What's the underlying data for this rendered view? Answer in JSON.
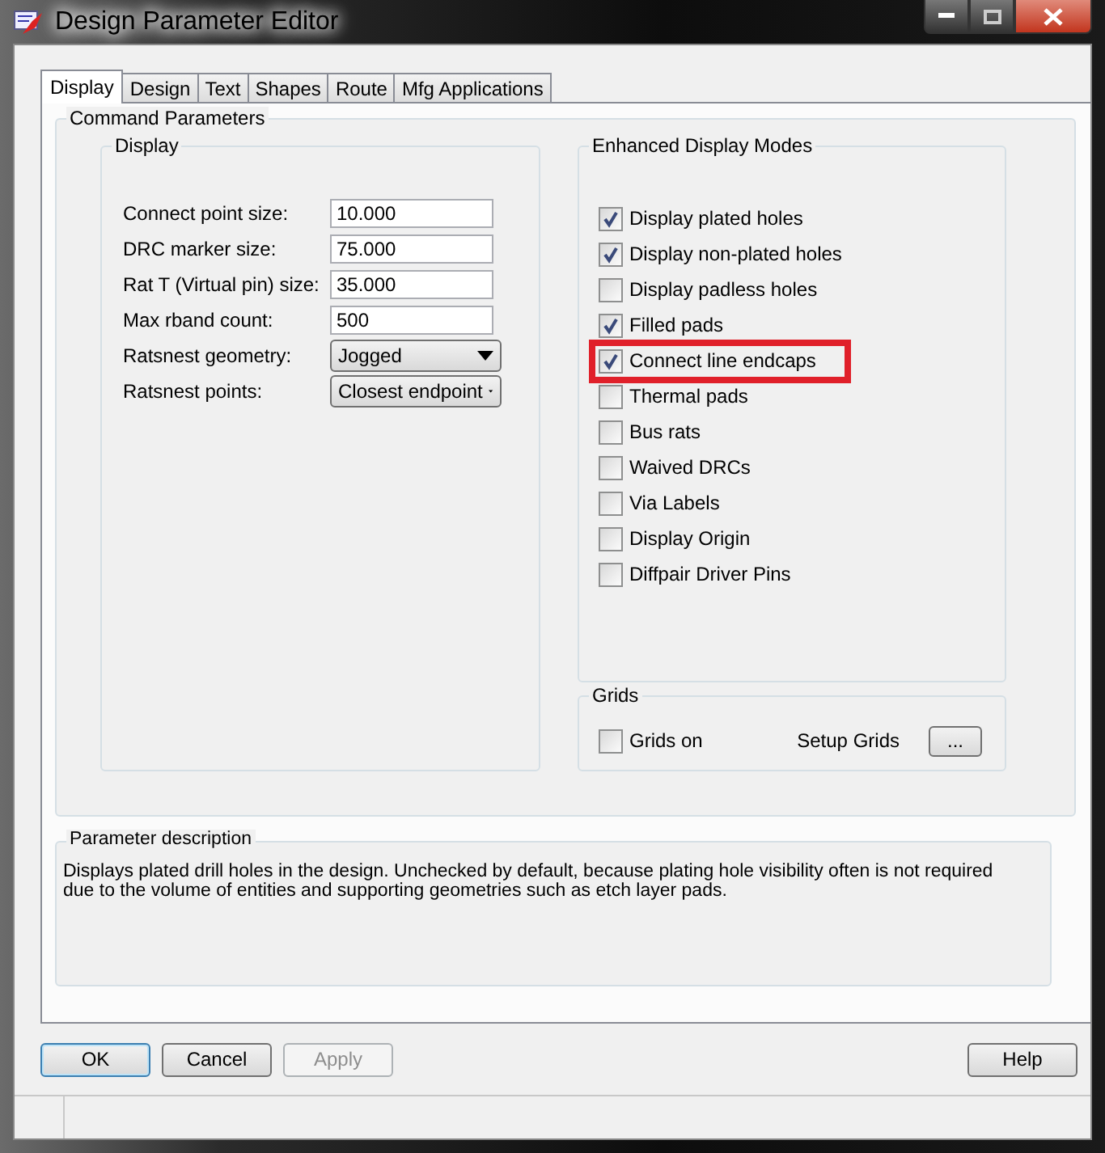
{
  "window": {
    "title": "Design Parameter Editor"
  },
  "tabs": [
    {
      "label": "Display",
      "selected": true
    },
    {
      "label": "Design",
      "selected": false
    },
    {
      "label": "Text",
      "selected": false
    },
    {
      "label": "Shapes",
      "selected": false
    },
    {
      "label": "Route",
      "selected": false
    },
    {
      "label": "Mfg Applications",
      "selected": false
    }
  ],
  "command_parameters": {
    "title": "Command Parameters",
    "display": {
      "title": "Display",
      "fields": [
        {
          "kind": "text",
          "label": "Connect point size:",
          "value": "10.000"
        },
        {
          "kind": "text",
          "label": "DRC marker size:",
          "value": "75.000"
        },
        {
          "kind": "text",
          "label": "Rat T (Virtual pin) size:",
          "value": "35.000"
        },
        {
          "kind": "text",
          "label": "Max rband count:",
          "value": "500"
        },
        {
          "kind": "dropdown",
          "label": "Ratsnest geometry:",
          "value": "Jogged"
        },
        {
          "kind": "dropdown",
          "label": "Ratsnest points:",
          "value": "Closest endpoint"
        }
      ]
    },
    "enhanced_display_modes": {
      "title": "Enhanced Display Modes",
      "options": [
        {
          "label": "Display plated holes",
          "checked": true
        },
        {
          "label": "Display non-plated holes",
          "checked": true
        },
        {
          "label": "Display padless holes",
          "checked": false
        },
        {
          "label": "Filled pads",
          "checked": true
        },
        {
          "label": "Connect line endcaps",
          "checked": true,
          "highlighted": true
        },
        {
          "label": "Thermal pads",
          "checked": false
        },
        {
          "label": "Bus rats",
          "checked": false
        },
        {
          "label": "Waived DRCs",
          "checked": false
        },
        {
          "label": "Via Labels",
          "checked": false
        },
        {
          "label": "Display Origin",
          "checked": false
        },
        {
          "label": "Diffpair Driver Pins",
          "checked": false
        }
      ]
    },
    "grids": {
      "title": "Grids",
      "grids_on": {
        "label": "Grids on",
        "checked": false
      },
      "setup_label": "Setup Grids",
      "setup_button": "..."
    }
  },
  "parameter_description": {
    "title": "Parameter description",
    "text": "Displays plated drill holes in the design. Unchecked by default, because plating hole visibility often is not required due to the volume of entities and supporting geometries such as etch layer pads."
  },
  "buttons": [
    {
      "label": "OK",
      "default": true,
      "disabled": false
    },
    {
      "label": "Cancel",
      "default": false,
      "disabled": false
    },
    {
      "label": "Apply",
      "default": false,
      "disabled": true
    },
    {
      "label": "Help",
      "default": false,
      "disabled": false
    }
  ]
}
